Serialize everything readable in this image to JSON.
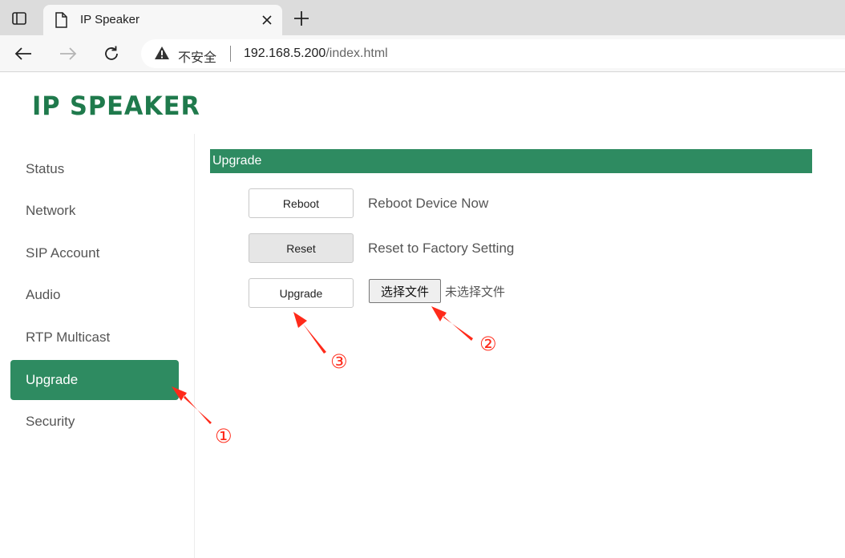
{
  "browser": {
    "tab_title": "IP Speaker",
    "security_label": "不安全",
    "url_host": "192.168.5.200",
    "url_path": "/index.html"
  },
  "header": {
    "logo": "IP SPEAKER"
  },
  "sidebar": {
    "items": [
      {
        "label": "Status"
      },
      {
        "label": "Network"
      },
      {
        "label": "SIP Account"
      },
      {
        "label": "Audio"
      },
      {
        "label": "RTP Multicast"
      },
      {
        "label": "Upgrade",
        "active": true
      },
      {
        "label": "Security"
      }
    ]
  },
  "main": {
    "section_title": "Upgrade",
    "actions": [
      {
        "button": "Reboot",
        "description": "Reboot Device Now"
      },
      {
        "button": "Reset",
        "description": "Reset to Factory Setting"
      },
      {
        "button": "Upgrade"
      }
    ],
    "file_button": "选择文件",
    "file_status": "未选择文件"
  },
  "annotations": {
    "markers": [
      "①",
      "②",
      "③"
    ],
    "color": "#ff2a1a"
  },
  "colors": {
    "accent": "#2e8b61",
    "logo": "#1f7a4c"
  }
}
